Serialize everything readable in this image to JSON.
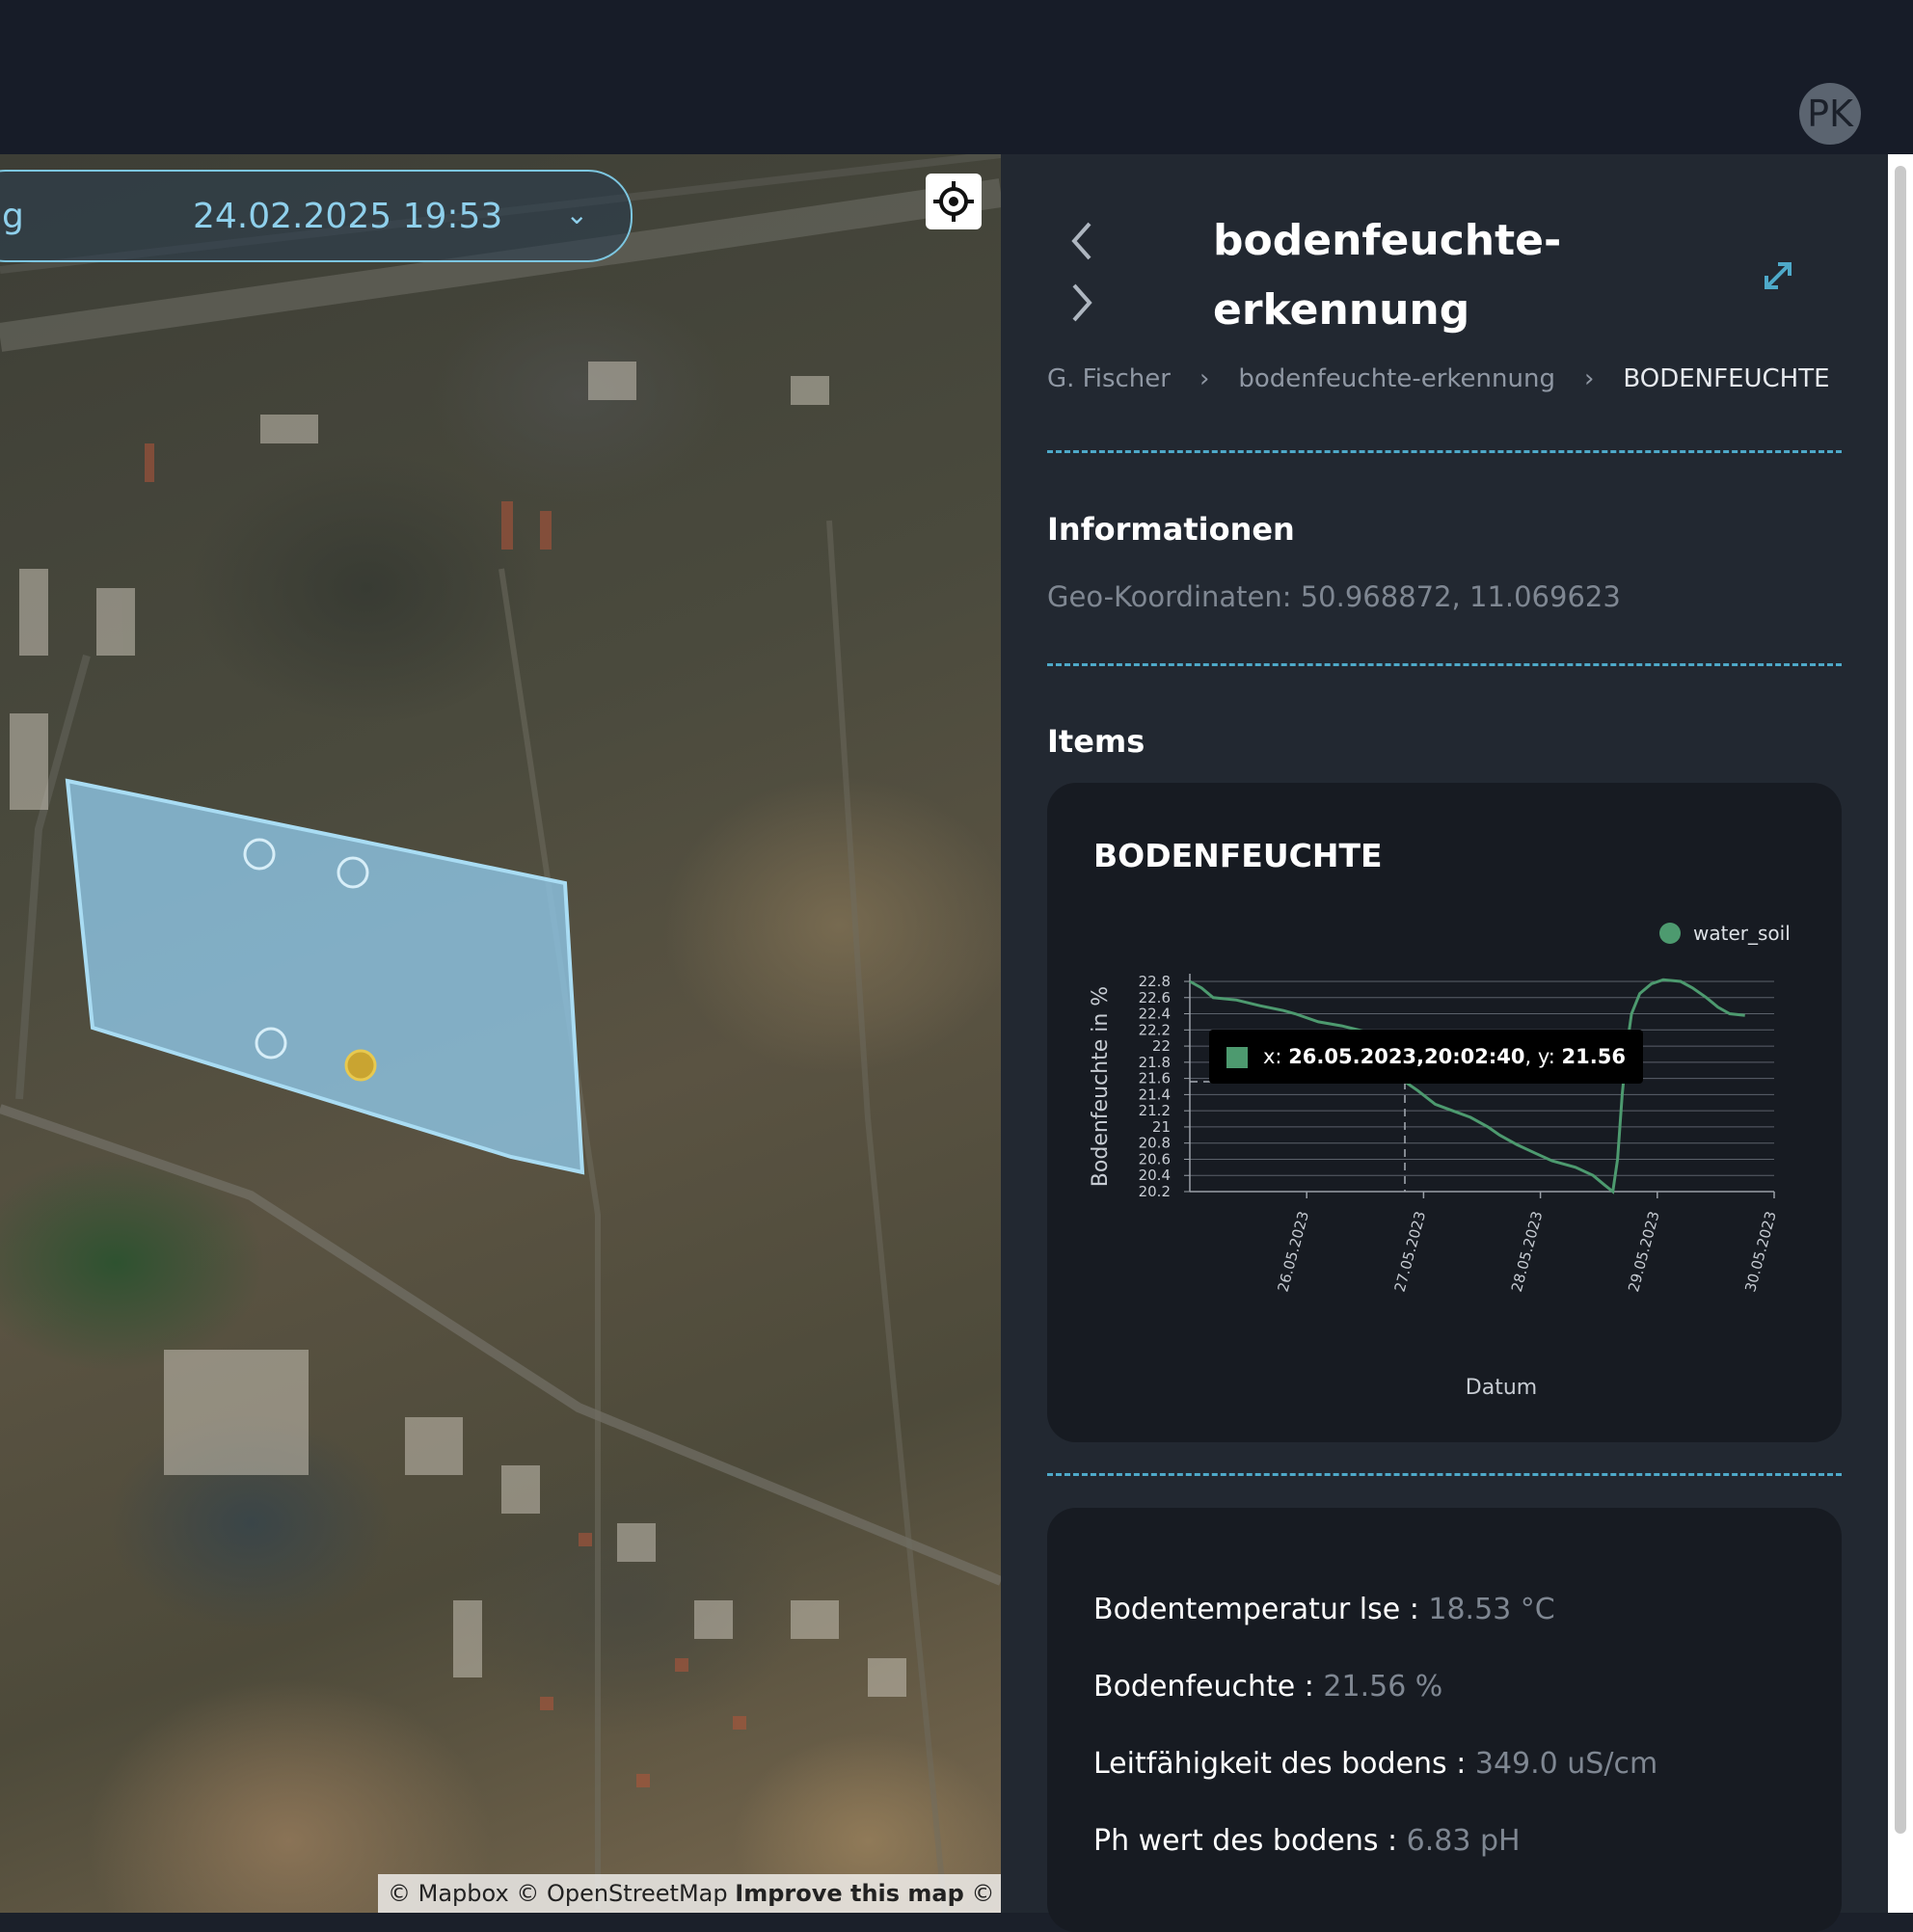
{
  "header": {
    "avatar_initials": "PK"
  },
  "map": {
    "date_picker": {
      "prefix_label": "g",
      "value": "24.02.2025 19:53"
    },
    "attribution": {
      "mapbox": "© Mapbox",
      "osm": "© OpenStreetMap",
      "improve": "Improve this map",
      "maxar": "© Maxar"
    },
    "colors": {
      "field_polygon": "#8fc9ea",
      "sensor_marker": "#9fd3ee",
      "active_marker": "#c9a431"
    }
  },
  "panel": {
    "title": "bodenfeuchte-erkennung",
    "breadcrumb": [
      "G. Fischer",
      "bodenfeuchte-erkennung",
      "BODENFEUCHTE"
    ],
    "breadcrumb_separator": "›",
    "info_heading": "Informationen",
    "geo": "Geo-Koordinaten: 50.968872, 11.069623",
    "items_heading": "Items",
    "chart_card_title": "BODENFEUCHTE",
    "metrics": [
      {
        "label": "Bodentemperatur lse : ",
        "value": "18.53 °C"
      },
      {
        "label": "Bodenfeuchte : ",
        "value": "21.56 %"
      },
      {
        "label": "Leitfähigkeit des bodens : ",
        "value": "349.0 uS/cm"
      },
      {
        "label": "Ph wert des bodens : ",
        "value": "6.83 pH"
      }
    ],
    "colors": {
      "accent": "#4ea9c9",
      "series": "#4d9a6f"
    }
  },
  "chart_data": {
    "type": "line",
    "xlabel": "Datum",
    "ylabel": "Bodenfeuchte in %",
    "ylim": [
      20.2,
      22.8
    ],
    "yticks": [
      "22.8",
      "22.6",
      "22.4",
      "22.2",
      "22",
      "21.8",
      "21.6",
      "21.4",
      "21.2",
      "21",
      "20.8",
      "20.6",
      "20.4",
      "20.2"
    ],
    "xticks": [
      "26.05.2023",
      "27.05.2023",
      "28.05.2023",
      "29.05.2023",
      "30.05.2023"
    ],
    "xtick_days": [
      1,
      2,
      3,
      4,
      5
    ],
    "xlim_days": [
      0,
      5
    ],
    "legend": {
      "position": "top-right",
      "entries": [
        "water_soil"
      ]
    },
    "grid": true,
    "series": [
      {
        "name": "water_soil",
        "color": "#4d9a6f",
        "points": [
          [
            0.0,
            22.8
          ],
          [
            0.1,
            22.72
          ],
          [
            0.2,
            22.6
          ],
          [
            0.4,
            22.57
          ],
          [
            0.6,
            22.5
          ],
          [
            0.8,
            22.44
          ],
          [
            0.9,
            22.4
          ],
          [
            1.1,
            22.3
          ],
          [
            1.3,
            22.25
          ],
          [
            1.5,
            22.18
          ],
          [
            1.6,
            22.05
          ],
          [
            1.7,
            21.85
          ],
          [
            1.8,
            21.7
          ],
          [
            1.84,
            21.56
          ],
          [
            1.95,
            21.45
          ],
          [
            2.1,
            21.28
          ],
          [
            2.25,
            21.2
          ],
          [
            2.4,
            21.12
          ],
          [
            2.55,
            21.0
          ],
          [
            2.65,
            20.9
          ],
          [
            2.8,
            20.78
          ],
          [
            2.95,
            20.68
          ],
          [
            3.1,
            20.58
          ],
          [
            3.3,
            20.5
          ],
          [
            3.45,
            20.4
          ],
          [
            3.55,
            20.28
          ],
          [
            3.62,
            20.2
          ],
          [
            3.66,
            20.6
          ],
          [
            3.7,
            21.4
          ],
          [
            3.74,
            22.0
          ],
          [
            3.78,
            22.4
          ],
          [
            3.85,
            22.65
          ],
          [
            3.95,
            22.77
          ],
          [
            4.05,
            22.82
          ],
          [
            4.2,
            22.8
          ],
          [
            4.3,
            22.72
          ],
          [
            4.42,
            22.6
          ],
          [
            4.52,
            22.48
          ],
          [
            4.62,
            22.4
          ],
          [
            4.75,
            22.38
          ]
        ]
      }
    ],
    "tooltip": {
      "x": "26.05.2023,20:02:40",
      "y": 21.56,
      "x_day": 1.84,
      "text_x": "x: ",
      "text_x_value": "26.05.2023,20:02:40",
      "text_y": ", y: ",
      "text_y_value": "21.56"
    }
  }
}
